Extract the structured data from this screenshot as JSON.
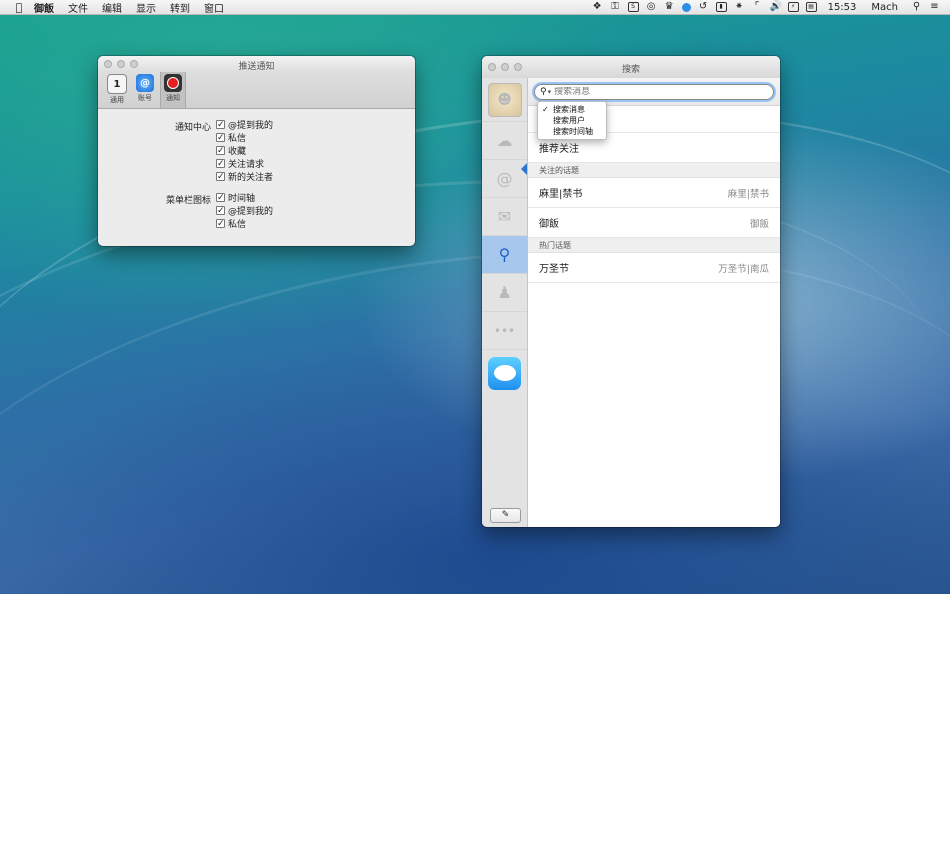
{
  "menubar": {
    "app_name": "御飯",
    "items": [
      "文件",
      "编辑",
      "显示",
      "转到",
      "窗口"
    ],
    "clock": "15:53",
    "user": "Mach",
    "status_icons": [
      "dropbox-icon",
      "key-icon",
      "sf-icon",
      "radar-icon",
      "evernote-icon",
      "blue-app-icon",
      "time-machine-icon",
      "battery-box-icon",
      "bluetooth-icon",
      "wifi-icon",
      "volume-icon",
      "battery-icon",
      "calendar-icon"
    ]
  },
  "prefs_window": {
    "title": "推送通知",
    "toolbar": [
      {
        "label": "通用",
        "icon": "general-icon"
      },
      {
        "label": "账号",
        "icon": "at-icon"
      },
      {
        "label": "通知",
        "icon": "record-icon"
      }
    ],
    "groups": [
      {
        "label": "通知中心",
        "options": [
          {
            "text": "@提到我的",
            "checked": true
          },
          {
            "text": "私信",
            "checked": true
          },
          {
            "text": "收藏",
            "checked": true
          },
          {
            "text": "关注请求",
            "checked": true
          },
          {
            "text": "新的关注者",
            "checked": true
          }
        ]
      },
      {
        "label": "菜单栏图标",
        "options": [
          {
            "text": "时间轴",
            "checked": true
          },
          {
            "text": "@提到我的",
            "checked": true
          },
          {
            "text": "私信",
            "checked": true
          }
        ]
      }
    ]
  },
  "search_window": {
    "title": "搜索",
    "search_placeholder": "搜索消息",
    "dropdown": [
      {
        "label": "搜索消息",
        "checked": true
      },
      {
        "label": "搜索用户",
        "checked": false
      },
      {
        "label": "搜索时间轴",
        "checked": false
      }
    ],
    "rows": [
      {
        "left": "推荐关注",
        "right": ""
      }
    ],
    "followed_topics_header": "关注的话题",
    "followed_topics": [
      {
        "left": "麻里|禁书",
        "right": "麻里|禁书"
      },
      {
        "left": "御飯",
        "right": "御飯"
      }
    ],
    "hot_topics_header": "热门话题",
    "hot_topics": [
      {
        "left": "万圣节",
        "right": "万圣节|南瓜"
      }
    ]
  }
}
